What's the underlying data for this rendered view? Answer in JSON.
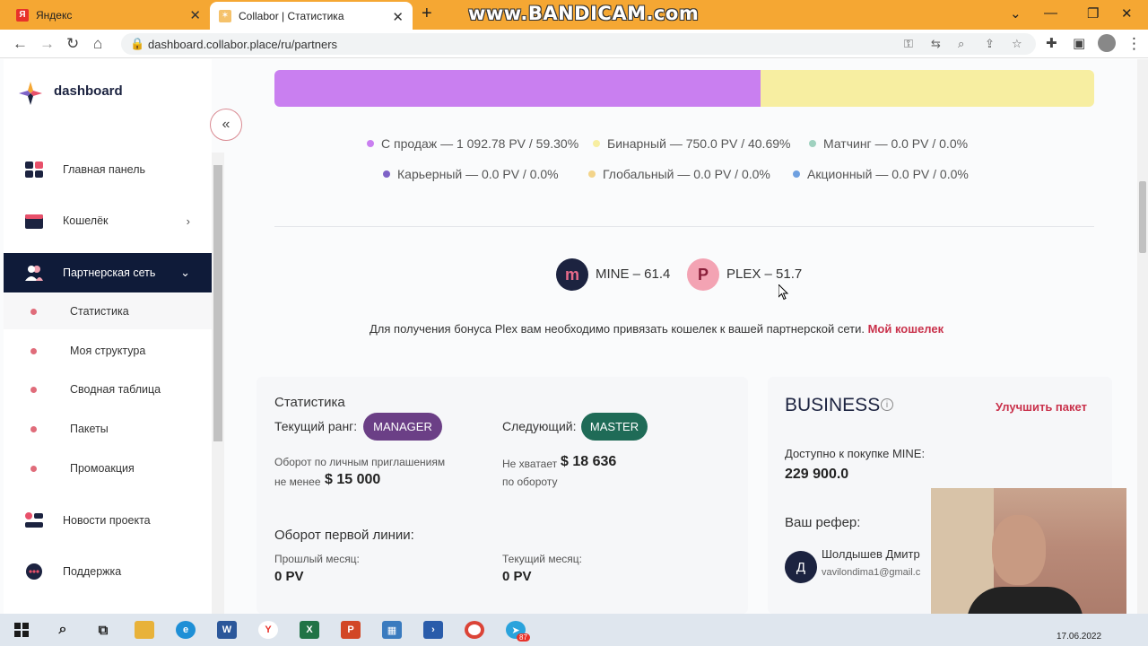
{
  "browser": {
    "tabs": [
      {
        "label": "Яндекс",
        "favicon": "yandex-icon"
      },
      {
        "label": "Collabor | Статистика",
        "favicon": "collabor-icon"
      }
    ],
    "watermark": "www.BANDICAM.com",
    "url": "dashboard.collabor.place/ru/partners"
  },
  "sidebar": {
    "logo": "dashboard",
    "items": [
      {
        "label": "Главная панель",
        "icon": "dashboard-grid-icon"
      },
      {
        "label": "Кошелёк",
        "icon": "wallet-icon"
      },
      {
        "label": "Партнерская сеть",
        "icon": "users-icon"
      },
      {
        "label": "Новости проекта",
        "icon": "news-icon"
      },
      {
        "label": "Поддержка",
        "icon": "chat-icon"
      }
    ],
    "subitems": [
      "Статистика",
      "Моя структура",
      "Сводная таблица",
      "Пакеты",
      "Промоакция"
    ]
  },
  "income_bar": {
    "sales_fraction": 0.593,
    "binary_fraction": 0.4069
  },
  "legend": [
    {
      "label": "С продаж",
      "value": "— 1 092.78 PV / 59.30%",
      "color": "#c97ff0"
    },
    {
      "label": "Бинарный",
      "value": "— 750.0 PV / 40.69%",
      "color": "#f7eea1"
    },
    {
      "label": "Матчинг",
      "value": "— 0.0 PV / 0.0%",
      "color": "#9fd1bf"
    },
    {
      "label": "Карьерный",
      "value": "— 0.0 PV / 0.0%",
      "color": "#7e62c7"
    },
    {
      "label": "Глобальный",
      "value": "— 0.0 PV / 0.0%",
      "color": "#f3d48a"
    },
    {
      "label": "Акционный",
      "value": "— 0.0 PV / 0.0%",
      "color": "#6ea0e0"
    }
  ],
  "coins": [
    {
      "symbol": "m",
      "text": "MINE – 61.4",
      "bg": "#1c2340",
      "fg": "#e86b8a"
    },
    {
      "symbol": "P",
      "text": "PLEX – 51.7",
      "bg": "#f3a3b3",
      "fg": "#8a1f3a"
    }
  ],
  "bonus_note": {
    "text": "Для получения бонуса Plex вам необходимо привязать кошелек к вашей партнерской сети.",
    "link": "Мой кошелек"
  },
  "stats": {
    "title": "Статистика",
    "current_rank_label": "Текущий ранг:",
    "current_rank": "MANAGER",
    "next_label": "Следующий:",
    "next_rank": "MASTER",
    "personal_turnover_line1": "Оборот по личным приглашениям",
    "personal_turnover_line2": "не менее",
    "personal_turnover_value": "$ 15 000",
    "missing_label": "Не хватает",
    "missing_value": "$ 18 636",
    "missing_suffix": "по обороту",
    "first_line_title": "Оборот первой линии:",
    "prev_month_label": "Прошлый месяц:",
    "prev_month_value": "0 PV",
    "cur_month_label": "Текущий месяц:",
    "cur_month_value": "0 PV"
  },
  "business": {
    "title": "BUSINESS",
    "upgrade": "Улучшить пакет",
    "available_label": "Доступно к покупке MINE:",
    "available_value": "229 900.0",
    "referrer_label": "Ваш рефер:",
    "referrer_initial": "Д",
    "referrer_name": "Шолдышев Дмитр",
    "referrer_email": "vavilondima1@gmail.c"
  },
  "taskbar": {
    "date": "17.06.2022",
    "telegram_badge": "87"
  }
}
